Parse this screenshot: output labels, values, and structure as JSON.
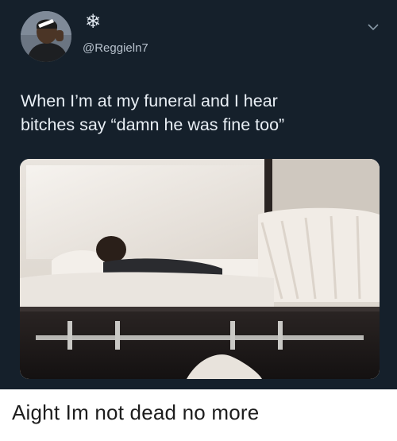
{
  "tweet": {
    "avatar_icon": "profile-avatar",
    "badge_icon": "snowflake-icon",
    "badge_glyph": "❄",
    "handle": "@Reggieln7",
    "menu_icon": "chevron-down-icon",
    "lines": [
      "When I’m at my funeral and I hear",
      "bitches say “damn he was fine too”"
    ],
    "media_icon": "coffin-photo"
  },
  "caption": "Aight Im not dead no more",
  "colors": {
    "tweet_background": "#15202b",
    "tweet_text": "#e8eef4",
    "handle_text": "#b7c1cc",
    "page_background": "#ffffff",
    "caption_text": "#1d1d1d"
  }
}
